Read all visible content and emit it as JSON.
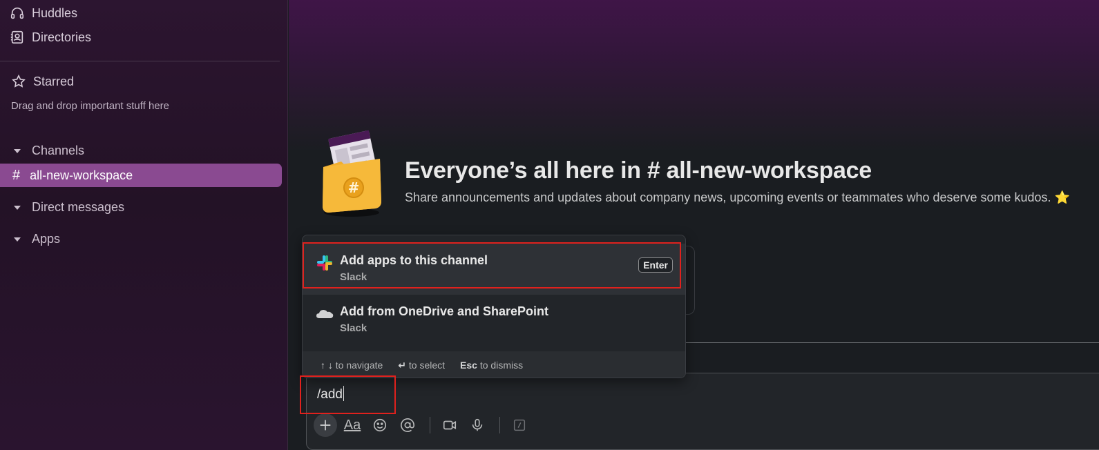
{
  "sidebar": {
    "huddles_label": "Huddles",
    "directories_label": "Directories",
    "starred_label": "Starred",
    "starred_hint": "Drag and drop important stuff here",
    "channels_label": "Channels",
    "active_channel": "all-new-workspace",
    "dm_label": "Direct messages",
    "apps_label": "Apps",
    "active_color": "#8a4a91"
  },
  "main": {
    "welcome_title": "Everyone’s all here in # all-new-workspace",
    "welcome_subtitle": "Share announcements and updates about company news, upcoming events or teammates who deserve some kudos. ⭐"
  },
  "popup": {
    "items": [
      {
        "title": "Add apps to this channel",
        "subtitle": "Slack",
        "shortcut": "Enter",
        "icon": "slack-logo-icon"
      },
      {
        "title": "Add from OneDrive and SharePoint",
        "subtitle": "Slack",
        "icon": "onedrive-cloud-icon"
      }
    ],
    "footer": {
      "navigate_keys": "↑ ↓",
      "navigate_text": "to navigate",
      "select_key": "↵",
      "select_text": "to select",
      "dismiss_key": "Esc",
      "dismiss_text": "to dismiss"
    }
  },
  "composer": {
    "value": "/add",
    "format_label": "Aa"
  },
  "highlight_color": "#e0211d"
}
